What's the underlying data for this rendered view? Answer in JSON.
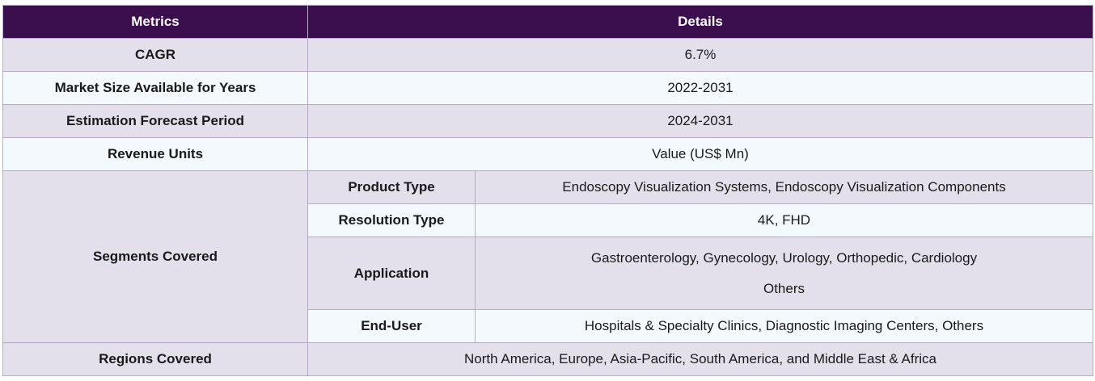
{
  "header": {
    "col1": "Metrics",
    "col2": "Details"
  },
  "rows": [
    {
      "label": "CAGR",
      "value": "6.7%"
    },
    {
      "label": "Market Size Available for Years",
      "value": "2022-2031"
    },
    {
      "label": "Estimation Forecast Period",
      "value": "2024-2031"
    },
    {
      "label": "Revenue Units",
      "value": "Value (US$ Mn)"
    }
  ],
  "segments": {
    "label": "Segments Covered",
    "items": [
      {
        "label": "Product Type",
        "value": "Endoscopy Visualization Systems, Endoscopy Visualization Components"
      },
      {
        "label": "Resolution Type",
        "value": "4K, FHD"
      },
      {
        "label": "Application",
        "value_line1": "Gastroenterology, Gynecology, Urology, Orthopedic, Cardiology",
        "value_line2": "Others"
      },
      {
        "label": "End-User",
        "value": "Hospitals & Specialty Clinics, Diagnostic Imaging Centers, Others"
      }
    ]
  },
  "regions": {
    "label": "Regions Covered",
    "value": "North America, Europe, Asia-Pacific, South America, and Middle East & Africa"
  },
  "colors": {
    "header_bg": "#3b0f4e",
    "row_shade": "#e3e0ec",
    "row_light": "#f3f9fc",
    "border": "#b7aac8"
  }
}
